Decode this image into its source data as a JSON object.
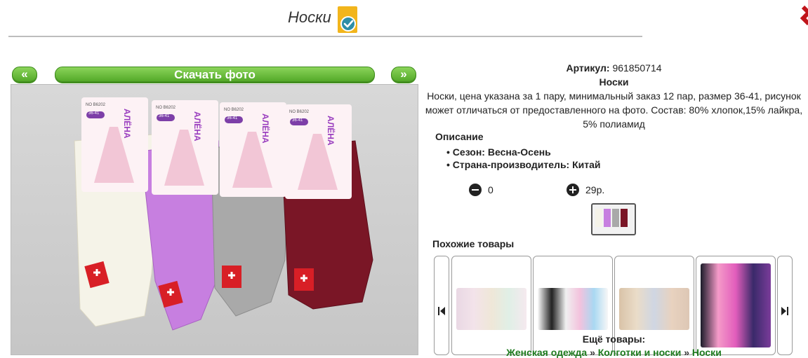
{
  "header": {
    "title": "Носки",
    "verified_icon": "verified-badge-icon",
    "close_icon": "close-icon"
  },
  "gallery": {
    "prev_label": "«",
    "next_label": "»",
    "download_label": "Скачать фото"
  },
  "product": {
    "article_label": "Артикул:",
    "article_value": "961850714",
    "name": "Носки",
    "description_line1": "Носки, цена указана за 1 пару, минимальный заказ 12 пар, размер 36-41, рисунок",
    "description_line2": "может отличаться от предоставленного на фото. Состав: 80% хлопок,15% лайкра,",
    "description_line3": "5% полиамид",
    "photo_labels": [
      "АЛЁНА",
      "АЛЁНА",
      "АЛЁНА",
      "АЛЁНА"
    ],
    "photo_codes": [
      "NO B6202",
      "NO B6202",
      "NO B6202",
      "NO B6202"
    ],
    "photo_sizes": [
      "36-41",
      "36-41",
      "36-41",
      "36-41"
    ]
  },
  "description": {
    "title": "Описание",
    "items": [
      "Сезон: Весна-Осень",
      "Страна-производитель: Китай"
    ]
  },
  "quantity": {
    "value": "0",
    "price": "29р."
  },
  "similar": {
    "title": "Похожие товары",
    "prev_icon": "skip-back-icon",
    "next_icon": "skip-forward-icon"
  },
  "more": {
    "title": "Ещё товары:",
    "crumbs": [
      "Женская одежда",
      "Колготки и носки",
      "Носки"
    ],
    "separator": "»"
  },
  "colors": {
    "accent_green": "#4ea524",
    "link_green": "#1e7a1e"
  }
}
